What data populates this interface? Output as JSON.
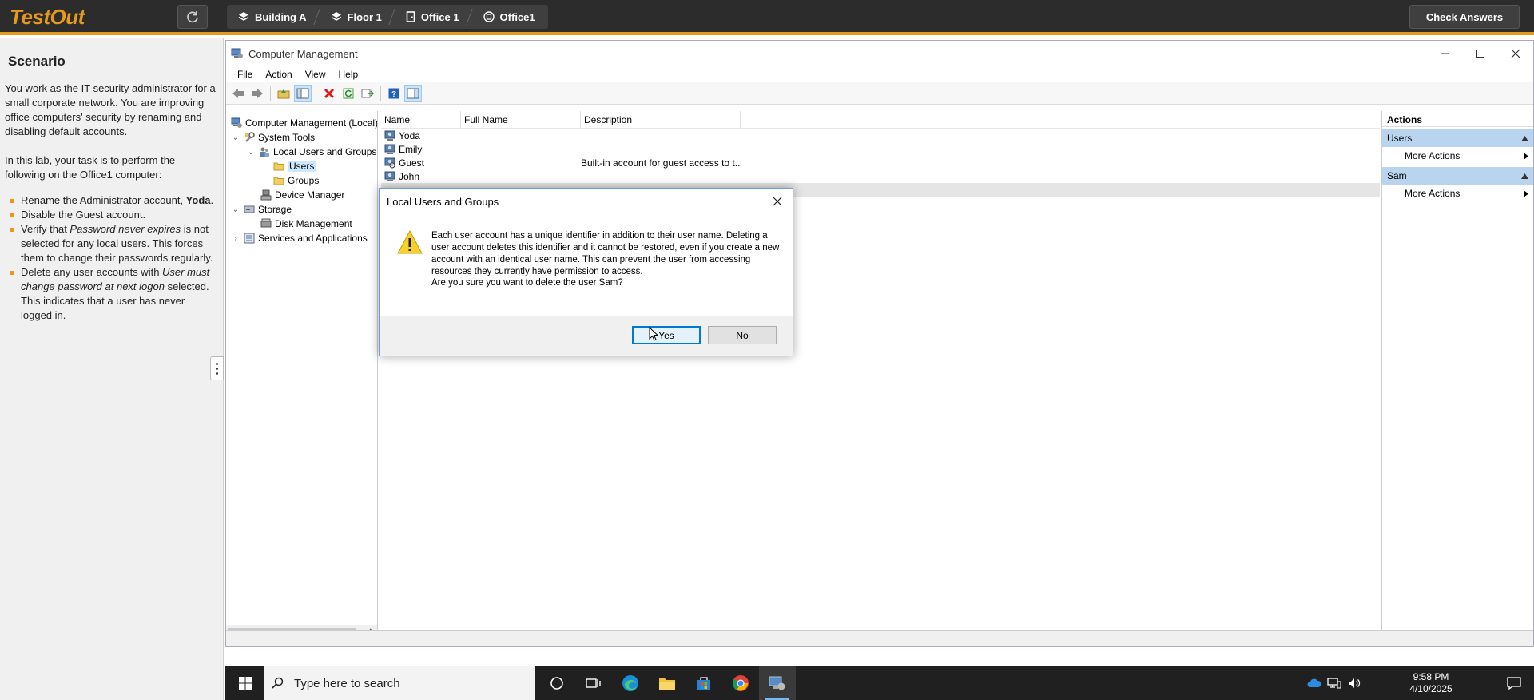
{
  "topbar": {
    "logo": "TestOut",
    "breadcrumbs": [
      {
        "label": "Building A",
        "icon": "layers-icon"
      },
      {
        "label": "Floor 1",
        "icon": "layers-icon"
      },
      {
        "label": "Office 1",
        "icon": "door-icon"
      },
      {
        "label": "Office1",
        "icon": "computer-circle-icon"
      }
    ],
    "check_answers": "Check Answers",
    "accent": "#e69a1c"
  },
  "scenario": {
    "heading": "Scenario",
    "intro": "You work as the IT security administrator for a small corporate network. You are improving office computers' security by renaming and disabling default accounts.",
    "task": "In this lab, your task is to perform the following on the Office1 computer:",
    "items": [
      {
        "pre": "Rename the Administrator account, ",
        "em": "",
        "bold": "Yoda",
        "post": "."
      },
      {
        "pre": "Disable the Guest account.",
        "em": "",
        "bold": "",
        "post": ""
      },
      {
        "pre": "Verify that ",
        "em": "Password never expires",
        "bold": "",
        "post": " is not selected for any local users. This forces them to change their passwords regularly."
      },
      {
        "pre": "Delete any user accounts with ",
        "em": "User must change password at next logon",
        "bold": "",
        "post": " selected. This indicates that a user has never logged in."
      }
    ]
  },
  "cm": {
    "title": "Computer Management",
    "menu": [
      "File",
      "Action",
      "View",
      "Help"
    ],
    "tree": [
      {
        "label": "Computer Management (Local)",
        "level": 0,
        "exp": "",
        "icon": "computer-management-icon"
      },
      {
        "label": "System Tools",
        "level": 1,
        "exp": "v",
        "icon": "tools-icon"
      },
      {
        "label": "Local Users and Groups",
        "level": 2,
        "exp": "v",
        "icon": "users-group-icon"
      },
      {
        "label": "Users",
        "level": 3,
        "exp": "",
        "icon": "folder-icon",
        "selected": true
      },
      {
        "label": "Groups",
        "level": 3,
        "exp": "",
        "icon": "folder-icon"
      },
      {
        "label": "Device Manager",
        "level": 2,
        "exp": "",
        "icon": "device-manager-icon"
      },
      {
        "label": "Storage",
        "level": 1,
        "exp": "v",
        "icon": "storage-icon"
      },
      {
        "label": "Disk Management",
        "level": 2,
        "exp": "",
        "icon": "disk-icon"
      },
      {
        "label": "Services and Applications",
        "level": 1,
        "exp": ">",
        "icon": "services-icon"
      }
    ],
    "columns": [
      "Name",
      "Full Name",
      "Description"
    ],
    "rows": [
      {
        "name": "Yoda",
        "full": "",
        "desc": ""
      },
      {
        "name": "Emily",
        "full": "",
        "desc": ""
      },
      {
        "name": "Guest",
        "full": "",
        "desc": "Built-in account for guest access to t..."
      },
      {
        "name": "John",
        "full": "",
        "desc": ""
      }
    ],
    "actions": {
      "header": "Actions",
      "sections": [
        {
          "title": "Users",
          "item": "More Actions"
        },
        {
          "title": "Sam",
          "item": "More Actions"
        }
      ]
    }
  },
  "dialog": {
    "title": "Local Users and Groups",
    "message": "Each user account has a unique identifier in addition to their user name. Deleting a user account deletes this identifier and it cannot be restored, even if you create a new account with an identical user name. This can prevent the user from accessing resources they currently have permission to access.",
    "question": "Are you sure you want to delete the user Sam?",
    "yes": "Yes",
    "no": "No"
  },
  "taskbar": {
    "search_placeholder": "Type here to search",
    "time": "9:58 PM",
    "date": "4/10/2025"
  }
}
